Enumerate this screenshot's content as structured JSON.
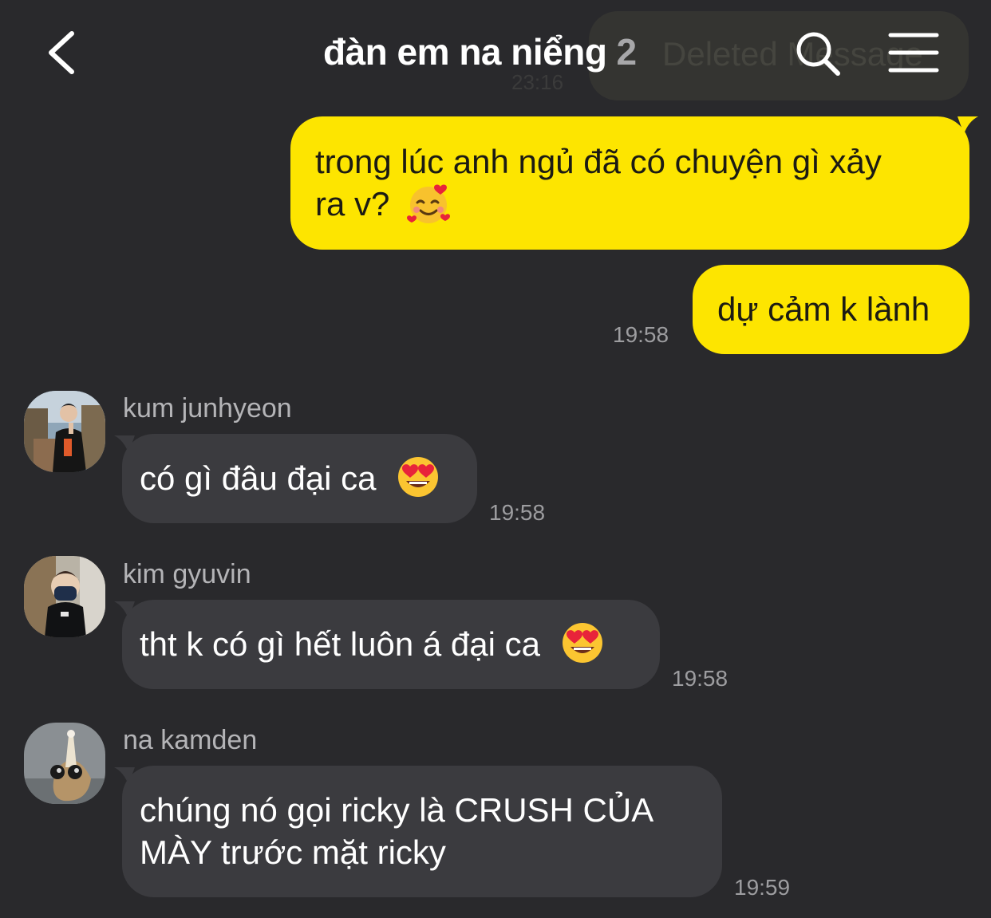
{
  "header": {
    "title": "đàn em na niểng",
    "member_count": "2"
  },
  "ghost": {
    "text": "Deleted Message",
    "time": "23:16"
  },
  "messages": [
    {
      "from": "me",
      "text_line1": "trong lúc anh ngủ đã có chuyện gì xảy",
      "text_line2": "ra v?",
      "emoji": "smiling-face-with-hearts"
    },
    {
      "from": "me",
      "text": "dự cảm k lành",
      "time": "19:58"
    },
    {
      "from": "them",
      "sender": "kum junhyeon",
      "text": "có gì đâu đại ca",
      "emoji": "heart-eyes",
      "time": "19:58"
    },
    {
      "from": "them",
      "sender": "kim gyuvin",
      "text": "tht k có gì hết luôn á đại ca",
      "emoji": "heart-eyes",
      "time": "19:58"
    },
    {
      "from": "them",
      "sender": "na kamden",
      "text_line1": "chúng nó gọi ricky là CRUSH CỦA",
      "text_line2": "MÀY trước mặt ricky",
      "time": "19:59"
    }
  ],
  "colors": {
    "background": "#29292c",
    "my_bubble": "#fde500",
    "their_bubble": "#3b3b3f",
    "time_text": "#9d9da0"
  }
}
